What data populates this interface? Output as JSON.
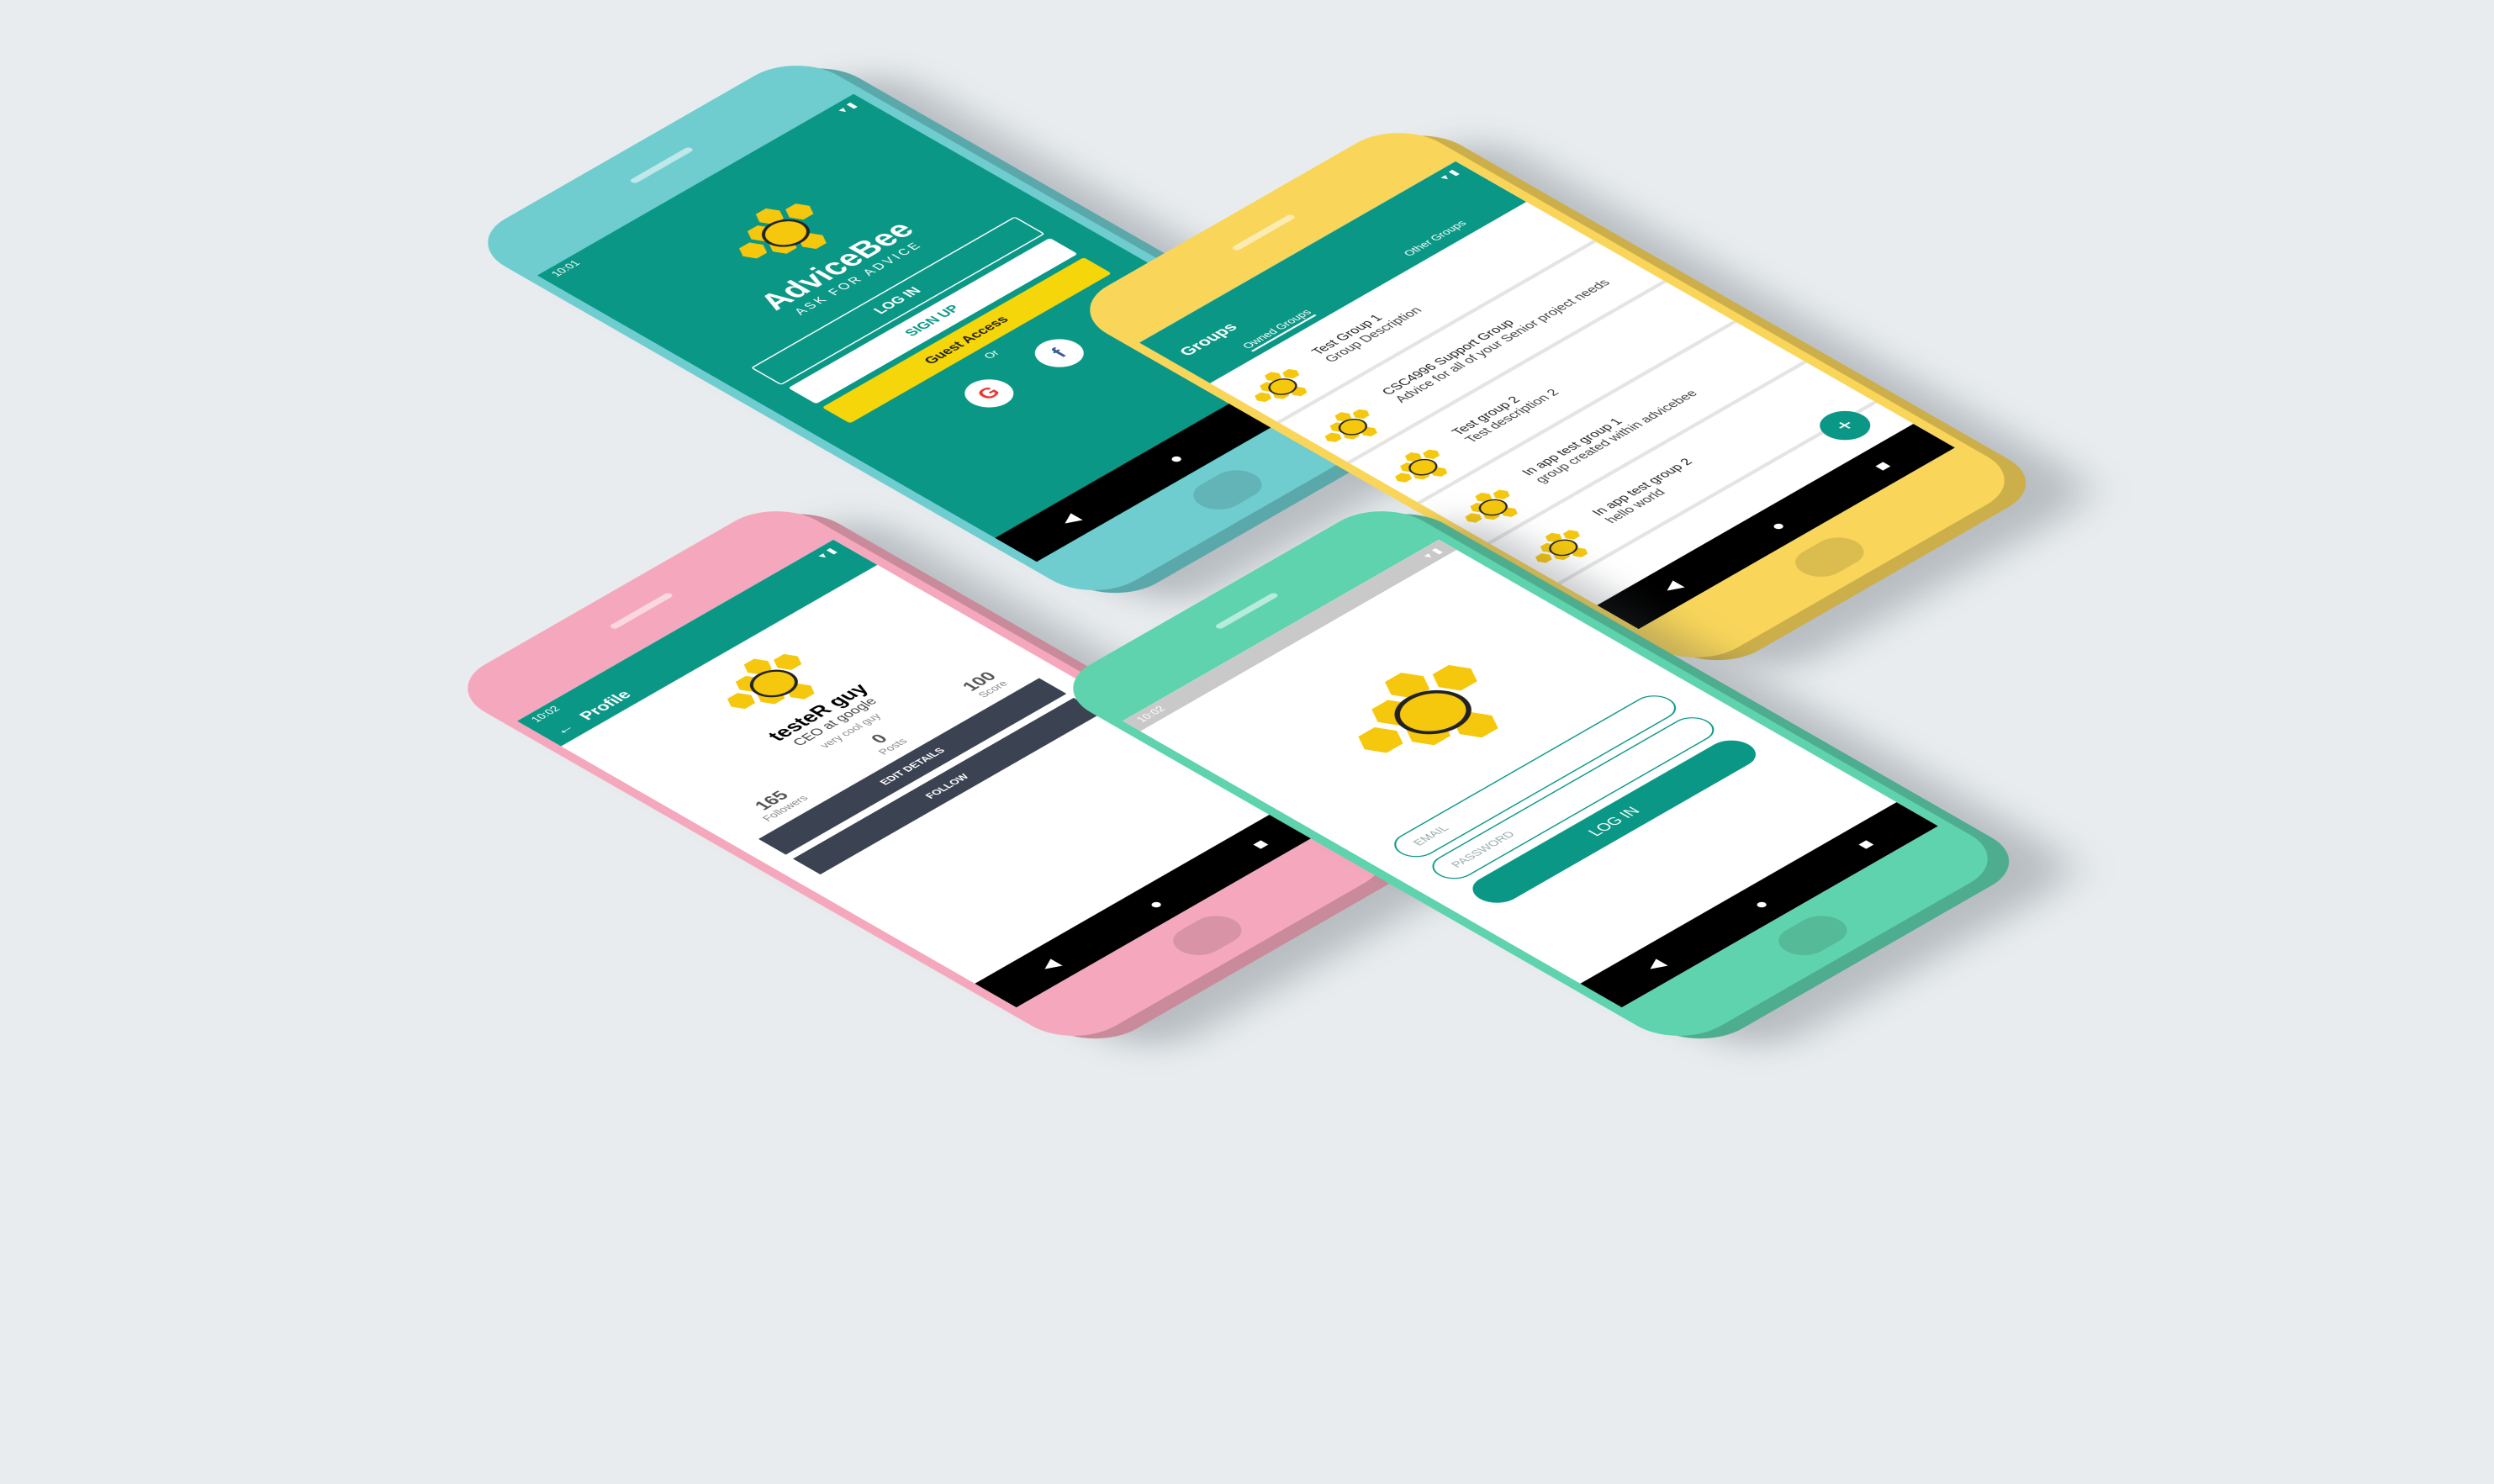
{
  "colors": {
    "teal": "#0b9786",
    "blue_phone": "#6fcdd0",
    "yellow_phone": "#f9d65a",
    "pink_phone": "#f5a8bd",
    "green_phone": "#5fd3ad",
    "bee_yellow": "#f5c70d",
    "background": "#e8ecee"
  },
  "login_phone": {
    "time": "10:01",
    "app_name": "AdviceBee",
    "tagline": "ASK FOR ADVICE",
    "login_label": "LOG IN",
    "signup_label": "SIGN UP",
    "guest_label": "Guest Access",
    "or_label": "Or",
    "google_glyph": "G",
    "facebook_glyph": "f",
    "icons": [
      "google-icon",
      "facebook-icon"
    ]
  },
  "groups_phone": {
    "title": "Groups",
    "tabs": [
      "Owned Groups",
      "Other Groups"
    ],
    "groups": [
      {
        "title": "Test Group 1",
        "desc": "Group Description"
      },
      {
        "title": "CSC4996 Support Group",
        "desc": "Advice for all of your Senior project needs"
      },
      {
        "title": "Test group 2",
        "desc": "Test description 2"
      },
      {
        "title": "In app test group 1",
        "desc": "group created within advicebee"
      },
      {
        "title": "In app test group 2",
        "desc": "hello world"
      }
    ],
    "fab_label": "+"
  },
  "profile_phone": {
    "time": "10:02",
    "title": "Profile",
    "name": "testeR guy",
    "job": "CEO at google",
    "bio": "very cool guy",
    "stats": [
      {
        "value": "165",
        "label": "Followers"
      },
      {
        "value": "0",
        "label": "Posts"
      },
      {
        "value": "100",
        "label": "Score"
      }
    ],
    "edit_label": "EDIT DETAILS",
    "follow_label": "FOLLOW"
  },
  "signin_phone": {
    "time": "10:02",
    "email_placeholder": "EMAIL",
    "password_placeholder": "PASSWORD",
    "login_label": "LOG IN"
  }
}
